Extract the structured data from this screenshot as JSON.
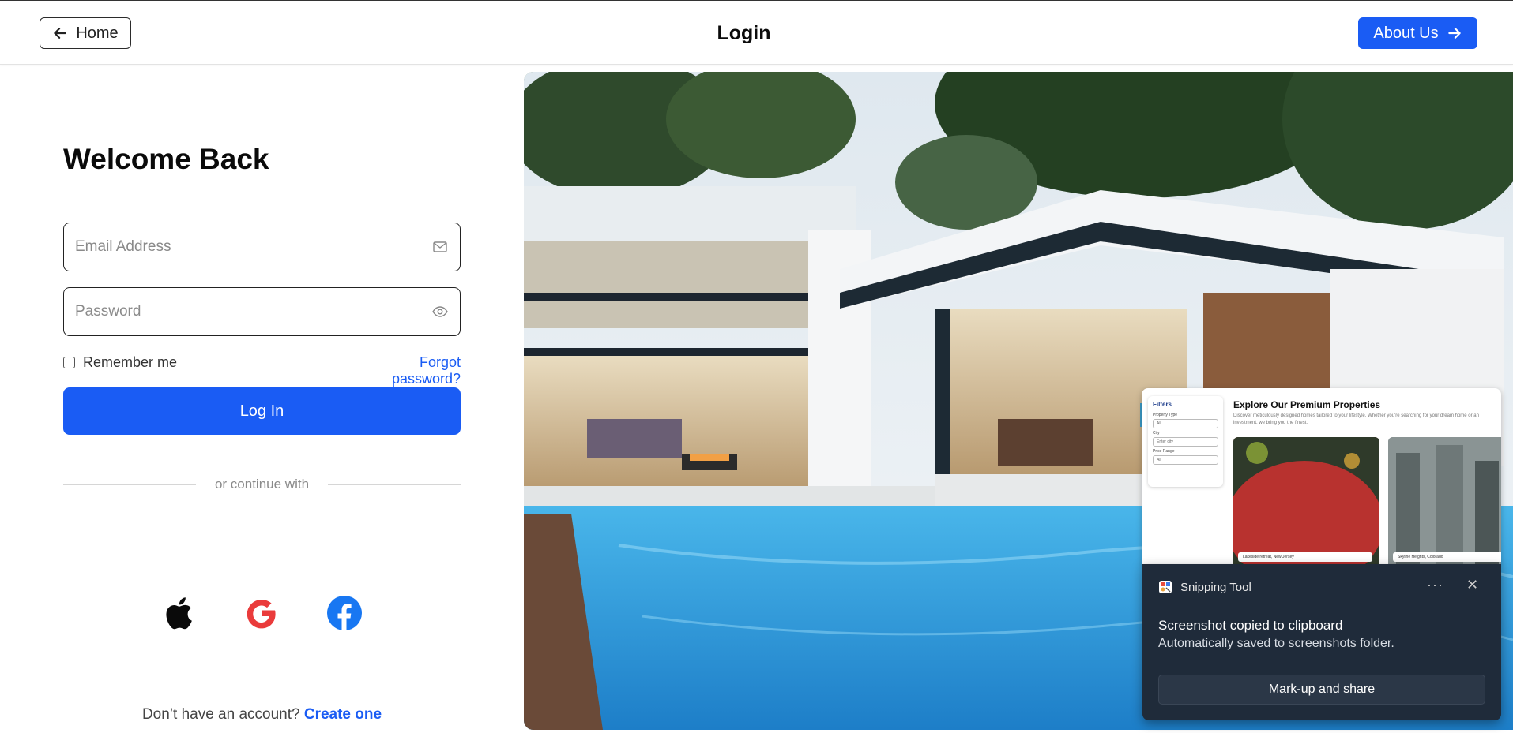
{
  "header": {
    "home_label": "Home",
    "title": "Login",
    "about_label": "About Us"
  },
  "form": {
    "heading": "Welcome Back",
    "email_placeholder": "Email Address",
    "password_placeholder": "Password",
    "remember_label": "Remember me",
    "forgot_label": "Forgot password?",
    "login_label": "Log In",
    "divider_text": "or continue with",
    "signup_prompt": "Don’t have an account?",
    "signup_link": "Create one"
  },
  "social": [
    "apple-icon",
    "google-icon",
    "facebook-icon"
  ],
  "preview": {
    "filters_title": "Filters",
    "labels": [
      "Property Type",
      "City",
      "Price Range"
    ],
    "values": [
      "All",
      "Enter city",
      "All"
    ],
    "title": "Explore Our Premium Properties",
    "subtitle": "Discover meticulously designed homes tailored to your lifestyle. Whether you're searching for your dream home or an investment, we bring you the finest.",
    "card1_caption": "Lakeside retreat, New Jersey",
    "card2_caption": "Skyline Heights, Colorado"
  },
  "toast": {
    "app_name": "Snipping Tool",
    "heading": "Screenshot copied to clipboard",
    "body": "Automatically saved to screenshots folder.",
    "action_label": "Mark-up and share",
    "more_glyph": "···",
    "close_glyph": "✕"
  },
  "colors": {
    "accent": "#1a5cf4",
    "toast_bg": "#1f2b3a"
  }
}
